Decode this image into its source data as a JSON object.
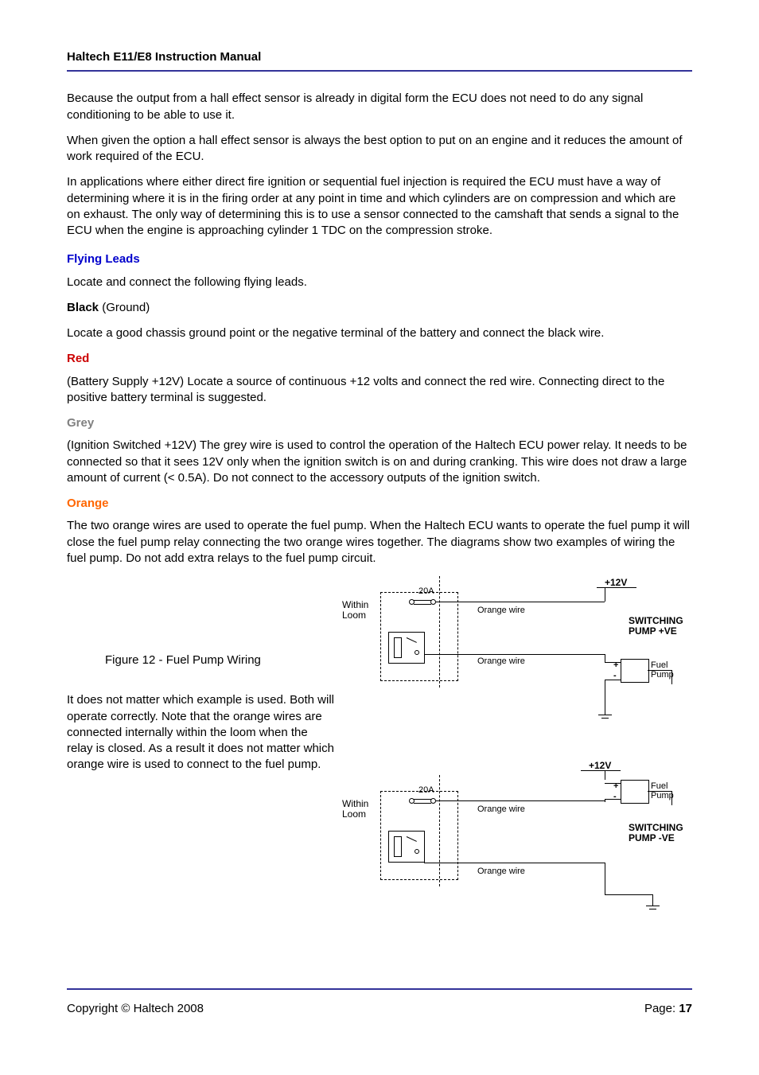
{
  "header": {
    "title": "Haltech E11/E8 Instruction Manual"
  },
  "body": {
    "p1": "Because the output from a hall effect sensor is already in digital form the ECU does not need to do any signal conditioning to be able to use it.",
    "p2": "When given the option a hall effect sensor is always the best option to put on an engine and it reduces the amount of work required of the ECU.",
    "p3": "In applications where either direct fire ignition or sequential fuel injection is required the ECU must have a way of determining where it is in the firing order at any point in time and which cylinders are on compression and which are on exhaust. The only way of determining this is to use a sensor connected to the camshaft that sends a signal to the ECU when the engine is approaching cylinder 1 TDC on the compression stroke.",
    "sec_flying": "Flying Leads",
    "p4": "Locate and connect the following flying leads.",
    "black_label": "Black",
    "black_paren": " (Ground)",
    "p5": "Locate a good chassis ground point or the negative terminal of the battery and connect the black wire.",
    "sec_red": "Red",
    "p6": "(Battery Supply +12V)  Locate a source of continuous +12 volts and connect the red wire. Connecting direct to the positive battery terminal is suggested.",
    "sec_grey": "Grey",
    "p7": "(Ignition Switched +12V) The grey wire is used to control the operation of the Haltech ECU power relay. It needs to be connected so that it sees 12V only when the ignition switch is on and during cranking. This wire does not draw a large amount of current (< 0.5A). Do not connect to the accessory outputs of the ignition switch.",
    "sec_orange": "Orange",
    "p8": "The two orange wires are used to operate the fuel pump. When the Haltech ECU wants to operate the fuel pump it will close the fuel pump relay connecting the two orange wires together. The diagrams show two examples of wiring the fuel pump. Do not add extra relays to the fuel pump circuit.",
    "fig_caption": "Figure 12 - Fuel Pump Wiring",
    "p9": "It does not matter which example is used. Both will operate correctly. Note that the orange wires are connected internally within the loom when the relay is closed. As a result it does not matter which orange wire is used to connect to the fuel pump."
  },
  "diagram": {
    "loom_label": "Within\nLoom",
    "fuse": "20A",
    "orange1": "Orange wire",
    "orange2": "Orange wire",
    "v12": "+12V",
    "title_pos": "SWITCHING\nPUMP +VE",
    "title_neg": "SWITCHING\nPUMP -VE",
    "pump": "Fuel\nPump"
  },
  "footer": {
    "copyright": "Copyright © Haltech 2008",
    "page_label": "Page: ",
    "page_num": "17"
  }
}
